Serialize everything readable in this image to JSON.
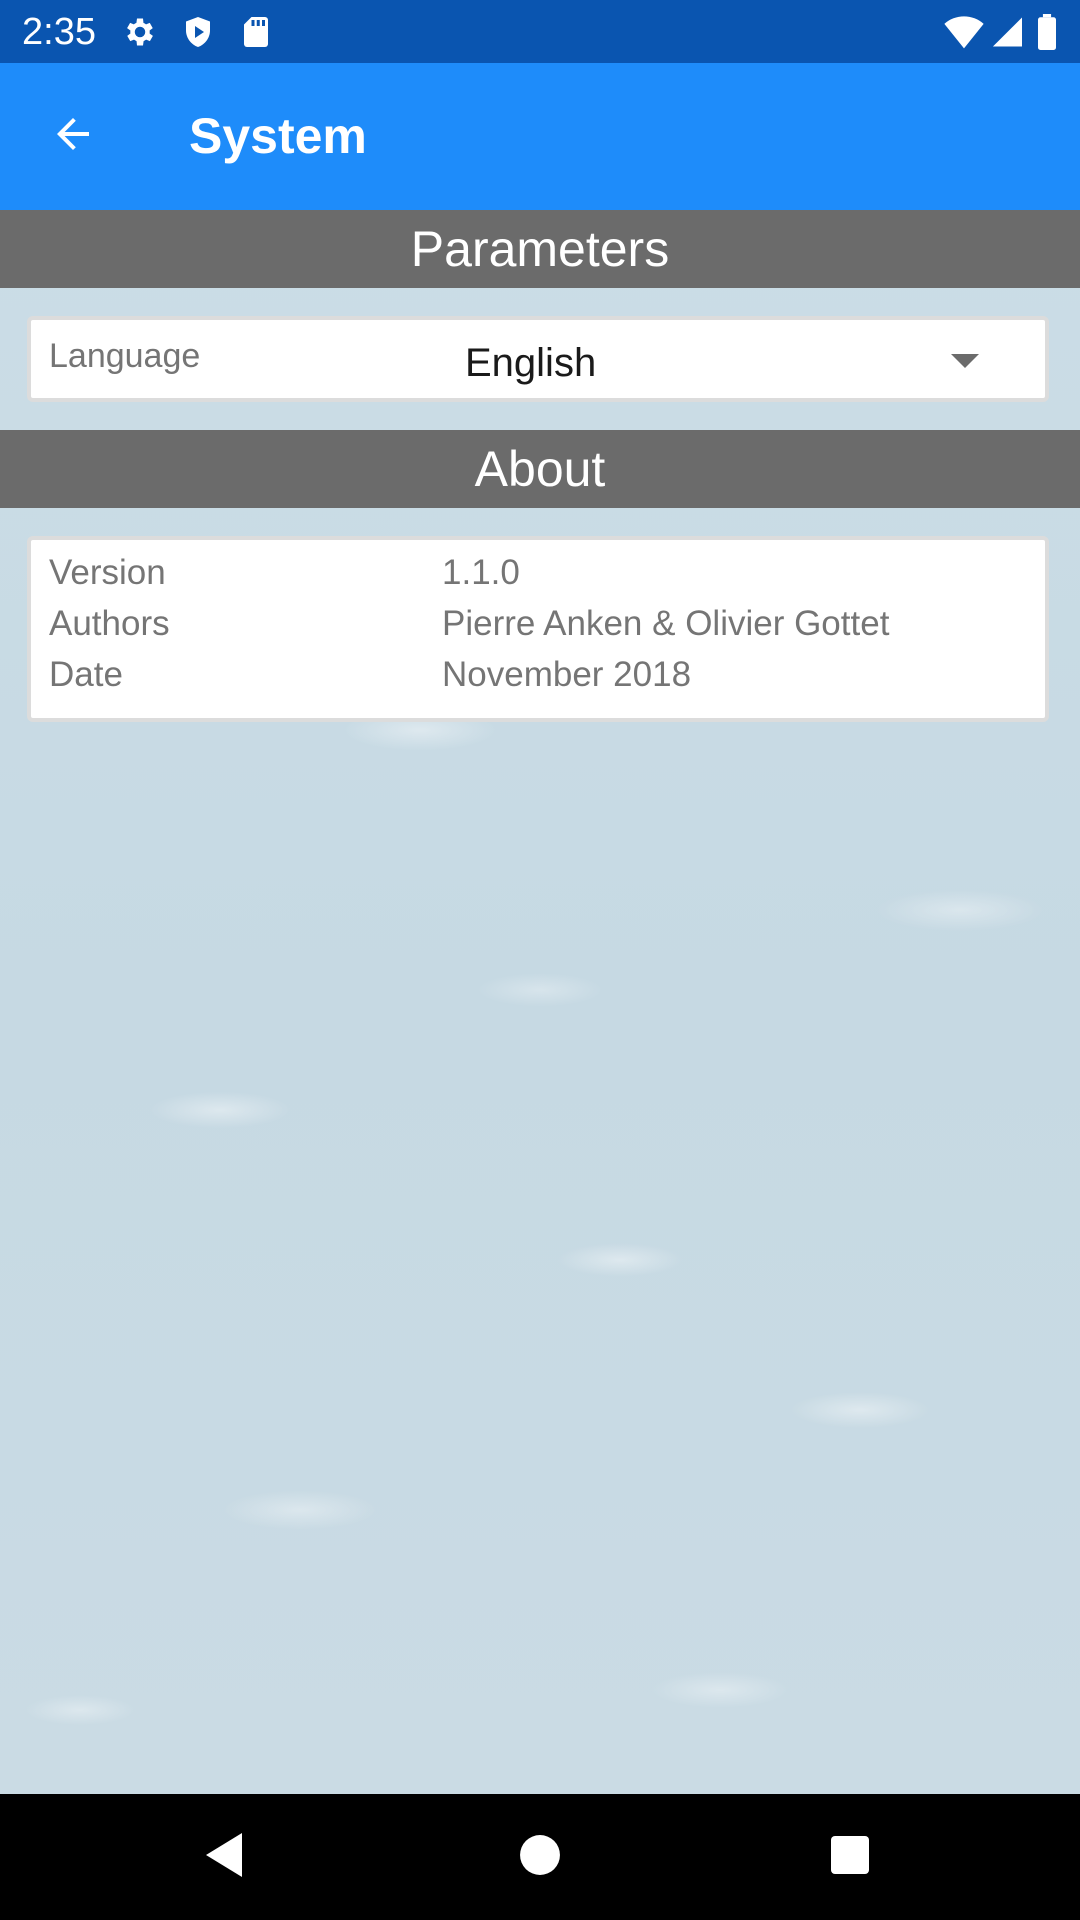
{
  "status_bar": {
    "time": "2:35",
    "left_icons": [
      "gear-icon",
      "shield-play-icon",
      "sd-card-icon"
    ],
    "right_icons": [
      "wifi-icon",
      "cell-signal-icon",
      "battery-icon"
    ]
  },
  "app_bar": {
    "title": "System",
    "back_icon": "arrow-left-icon",
    "color": "#1e8cfa"
  },
  "parameters_section": {
    "header": "Parameters",
    "language": {
      "label": "Language",
      "value": "English"
    }
  },
  "about_section": {
    "header": "About",
    "rows": [
      {
        "key": "Version",
        "value": "1.1.0"
      },
      {
        "key": "Authors",
        "value": "Pierre Anken & Olivier Gottet"
      },
      {
        "key": "Date",
        "value": "November 2018"
      }
    ]
  },
  "nav_bar": {
    "buttons": [
      "back-triangle-icon",
      "home-circle-icon",
      "recents-square-icon"
    ]
  }
}
